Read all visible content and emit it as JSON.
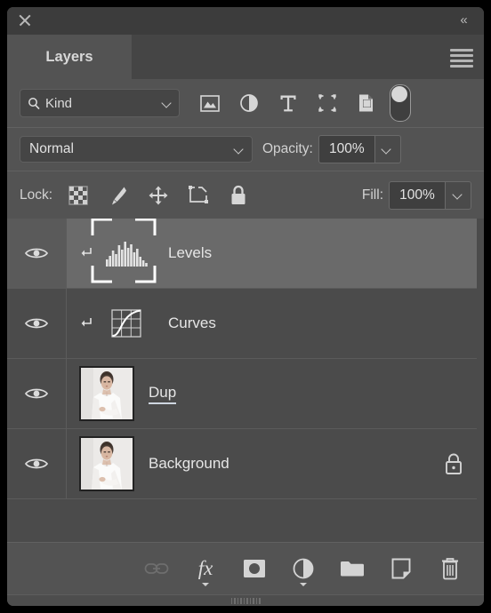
{
  "window": {
    "close_label": "close-window",
    "collapse_label": "«"
  },
  "tabs": [
    {
      "label": "Layers",
      "active": true
    }
  ],
  "panel_menu": {
    "label": "panel-menu"
  },
  "filter_bar": {
    "kind_label": "Kind",
    "search_icon": "search-icon",
    "dropdown_icon": "chevron-down-icon",
    "filter_icons": [
      {
        "name": "pixel-layers-filter-icon",
        "title": "Filter for pixel layers"
      },
      {
        "name": "adjustment-layers-filter-icon",
        "title": "Filter for adjustment layers"
      },
      {
        "name": "type-layers-filter-icon",
        "title": "Filter for type layers"
      },
      {
        "name": "shape-layers-filter-icon",
        "title": "Filter for shape layers"
      },
      {
        "name": "smart-object-filter-icon",
        "title": "Filter for smart objects"
      }
    ],
    "toggle": {
      "name": "filter-enable-toggle",
      "state": "off"
    }
  },
  "blend_bar": {
    "blend_mode": "Normal",
    "opacity_label": "Opacity:",
    "opacity_value": "100%"
  },
  "lock_bar": {
    "lock_label": "Lock:",
    "lock_icons": [
      {
        "name": "lock-transparent-pixels-icon"
      },
      {
        "name": "lock-image-pixels-icon"
      },
      {
        "name": "lock-position-icon"
      },
      {
        "name": "lock-artboard-nesting-icon"
      },
      {
        "name": "lock-all-icon"
      }
    ],
    "fill_label": "Fill:",
    "fill_value": "100%"
  },
  "layers": [
    {
      "name": "Levels",
      "type": "adjustment",
      "thumb": "levels-histogram-icon",
      "visible": true,
      "selected": true,
      "clipped": true,
      "editing": false,
      "locked": false
    },
    {
      "name": "Curves",
      "type": "adjustment",
      "thumb": "curves-grid-icon",
      "visible": true,
      "selected": false,
      "clipped": true,
      "editing": false,
      "locked": false
    },
    {
      "name": "Dup",
      "type": "pixel",
      "thumb": "portrait-photo-thumbnail",
      "visible": true,
      "selected": false,
      "clipped": false,
      "editing": true,
      "locked": false
    },
    {
      "name": "Background",
      "type": "pixel",
      "thumb": "portrait-photo-thumbnail",
      "visible": true,
      "selected": false,
      "clipped": false,
      "editing": false,
      "locked": true
    }
  ],
  "bottom_bar": {
    "buttons": [
      {
        "name": "link-layers-button",
        "label": "Link layers",
        "disabled": true,
        "caret": false
      },
      {
        "name": "layer-style-button",
        "label": "fx",
        "disabled": false,
        "caret": true
      },
      {
        "name": "add-layer-mask-button",
        "label": "Add layer mask",
        "disabled": false,
        "caret": false
      },
      {
        "name": "new-adjustment-layer-button",
        "label": "New adjustment layer",
        "disabled": false,
        "caret": true
      },
      {
        "name": "new-group-button",
        "label": "New group",
        "disabled": false,
        "caret": false
      },
      {
        "name": "new-layer-button",
        "label": "New layer",
        "disabled": false,
        "caret": false
      },
      {
        "name": "delete-layer-button",
        "label": "Delete layer",
        "disabled": false,
        "caret": false
      }
    ]
  },
  "colors": {
    "panel_bg": "#535353",
    "list_bg": "#4b4b4b",
    "selected_row": "#6a6a6a",
    "titlebar": "#3c3c3c",
    "text": "#e6e6e6"
  }
}
